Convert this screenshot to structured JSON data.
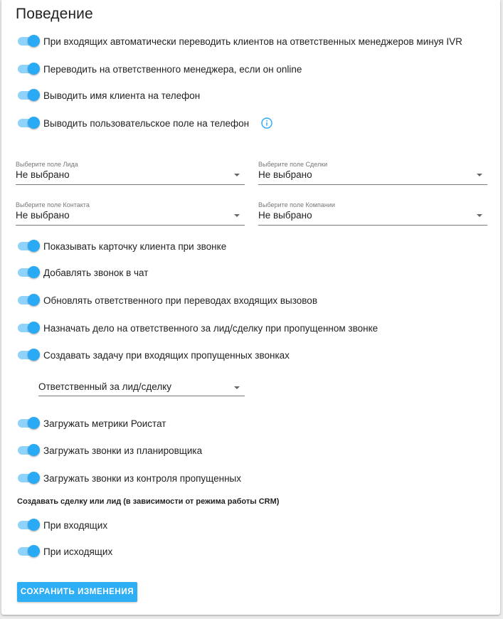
{
  "section": {
    "title": "Поведение"
  },
  "toggles_top": [
    {
      "label": "При входящих автоматически переводить клиентов на ответственных менеджеров минуя IVR",
      "checked": true
    },
    {
      "label": "Переводить на ответственного менеджера, если он online",
      "checked": true
    },
    {
      "label": "Выводить имя клиента на телефон",
      "checked": true
    },
    {
      "label": "Выводить пользовательское поле на телефон",
      "checked": true
    }
  ],
  "info_icon": "info-circle-icon",
  "fields": {
    "lead": {
      "label": "Выберите поле Лида",
      "value": "Не выбрано"
    },
    "deal": {
      "label": "Выберите поле Сделки",
      "value": "Не выбрано"
    },
    "contact": {
      "label": "Выберите поле Контакта",
      "value": "Не выбрано"
    },
    "company": {
      "label": "Выберите поле Компании",
      "value": "Не выбрано"
    }
  },
  "toggles_middle": [
    {
      "label": "Показывать карточку клиента при звонке",
      "checked": true
    },
    {
      "label": "Добавлять звонок в чат",
      "checked": true
    },
    {
      "label": "Обновлять ответственного при переводах входящих вызовов",
      "checked": true
    },
    {
      "label": "Назначать дело на ответственного за лид/сделку при пропущенном звонке",
      "checked": true
    },
    {
      "label": "Создавать задачу при входящих пропущенных звонках",
      "checked": true
    }
  ],
  "task_assignee": {
    "value": "Ответственный за лид/сделку"
  },
  "toggles_bottom": [
    {
      "label": "Загружать метрики Роистат",
      "checked": true
    },
    {
      "label": "Загружать звонки из планировщика",
      "checked": true
    },
    {
      "label": "Загружать звонки из контроля пропущенных",
      "checked": true
    }
  ],
  "create_deal": {
    "heading": "Создавать сделку или лид (в зависимости от режима работы CRM)",
    "toggles": [
      {
        "label": "При входящих",
        "checked": true
      },
      {
        "label": "При исходящих",
        "checked": true
      }
    ]
  },
  "save_button": {
    "label": "СОХРАНИТЬ ИЗМЕНЕНИЯ"
  },
  "colors": {
    "accent": "#2aa9f5",
    "track": "#8fd3fb",
    "button": "#2eaef5"
  }
}
